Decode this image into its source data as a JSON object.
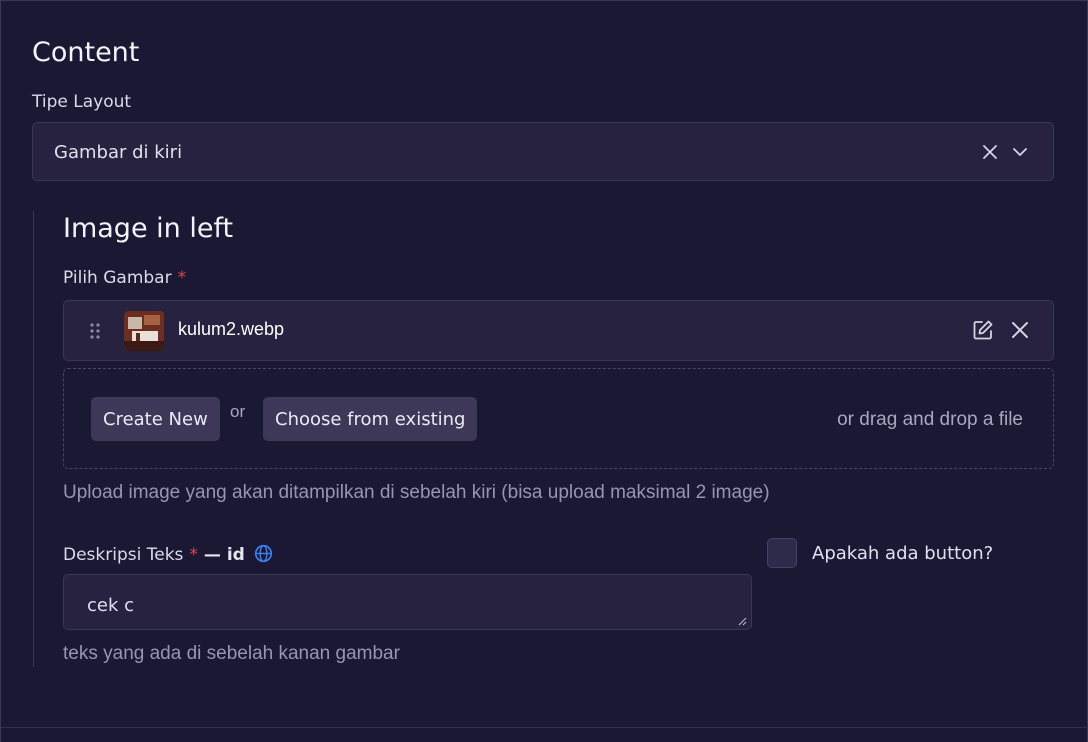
{
  "content": {
    "title": "Content",
    "layout_label": "Tipe Layout",
    "layout_value": "Gambar di kiri"
  },
  "image_left": {
    "title": "Image in left",
    "image_label": "Pilih Gambar",
    "required_mark": "*",
    "file": {
      "name": "kulum2.webp"
    },
    "create_new_label": "Create New",
    "or_label": "or",
    "choose_existing_label": "Choose from existing",
    "drag_drop_label": "or drag and drop a file",
    "image_helper": "Upload image yang akan ditampilkan di sebelah kiri (bisa upload maksimal 2 image)",
    "description_label": "Deskripsi Teks",
    "locale_label": "— id",
    "description_value": "cek c",
    "description_helper": "teks yang ada di sebelah kanan gambar",
    "button_checkbox_label": "Apakah ada button?"
  },
  "colors": {
    "background": "#1b1833",
    "field": "#26223f",
    "required": "#e0484f",
    "globe_icon": "#3b82f6"
  },
  "icons": [
    "clear-icon",
    "chevron-down-icon",
    "drag-handle-icon",
    "edit-icon",
    "remove-icon",
    "globe-icon"
  ]
}
